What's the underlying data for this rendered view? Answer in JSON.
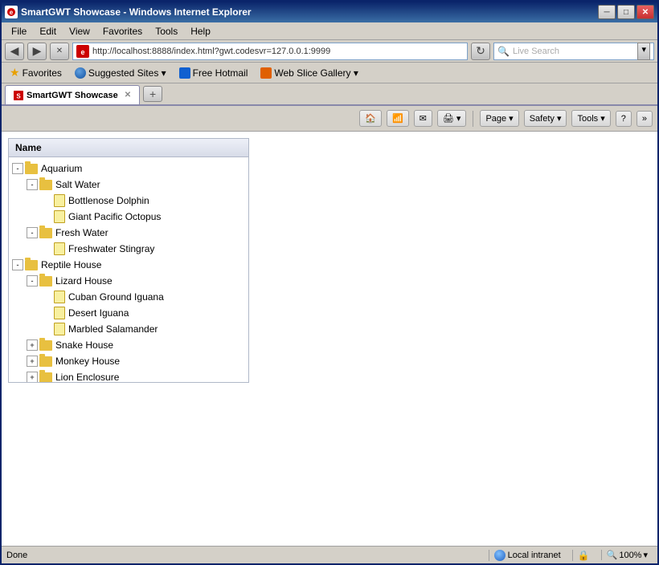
{
  "window": {
    "title": "SmartGWT Showcase - Windows Internet Explorer",
    "favicon_text": "e"
  },
  "titlebar": {
    "title": "SmartGWT Showcase - Windows Internet Explorer",
    "minimize": "─",
    "maximize": "□",
    "close": "✕"
  },
  "addressbar": {
    "url": "http://localhost:8888/index.html?gwt.codesvr=127.0.0.1:9999",
    "search_placeholder": "Live Search"
  },
  "menu": {
    "items": [
      "File",
      "Edit",
      "View",
      "Favorites",
      "Tools",
      "Help"
    ]
  },
  "favorites_bar": {
    "items": [
      {
        "label": "Favorites",
        "has_chevron": false
      },
      {
        "label": "Suggested Sites ▾",
        "has_chevron": false
      },
      {
        "label": "Free Hotmail",
        "has_chevron": false
      },
      {
        "label": "Web Slice Gallery ▾",
        "has_chevron": false
      }
    ]
  },
  "tab": {
    "label": "SmartGWT Showcase",
    "close": "✕"
  },
  "toolbar": {
    "page_label": "Page ▾",
    "safety_label": "Safety ▾",
    "tools_label": "Tools ▾",
    "help_label": "?"
  },
  "tree": {
    "header": "Name",
    "nodes": [
      {
        "id": 1,
        "level": 0,
        "type": "folder",
        "label": "Aquarium",
        "expand": "-",
        "expanded": true
      },
      {
        "id": 2,
        "level": 1,
        "type": "folder",
        "label": "Salt Water",
        "expand": "-",
        "expanded": true
      },
      {
        "id": 3,
        "level": 2,
        "type": "leaf",
        "label": "Bottlenose Dolphin"
      },
      {
        "id": 4,
        "level": 2,
        "type": "leaf",
        "label": "Giant Pacific Octopus"
      },
      {
        "id": 5,
        "level": 1,
        "type": "folder",
        "label": "Fresh Water",
        "expand": "-",
        "expanded": true
      },
      {
        "id": 6,
        "level": 2,
        "type": "leaf",
        "label": "Freshwater Stingray"
      },
      {
        "id": 7,
        "level": 0,
        "type": "folder",
        "label": "Reptile House",
        "expand": "-",
        "expanded": true
      },
      {
        "id": 8,
        "level": 1,
        "type": "folder",
        "label": "Lizard House",
        "expand": "-",
        "expanded": true
      },
      {
        "id": 9,
        "level": 2,
        "type": "leaf",
        "label": "Cuban Ground Iguana"
      },
      {
        "id": 10,
        "level": 2,
        "type": "leaf",
        "label": "Desert Iguana"
      },
      {
        "id": 11,
        "level": 2,
        "type": "leaf",
        "label": "Marbled Salamander"
      },
      {
        "id": 12,
        "level": 1,
        "type": "folder",
        "label": "Snake House",
        "expand": "+",
        "expanded": false
      },
      {
        "id": 13,
        "level": 1,
        "type": "folder",
        "label": "Monkey House",
        "expand": "+",
        "expanded": false
      },
      {
        "id": 14,
        "level": 1,
        "type": "folder",
        "label": "Lion Enclosure",
        "expand": "+",
        "expanded": false
      }
    ]
  },
  "statusbar": {
    "status": "Done",
    "zone": "Local intranet",
    "zoom": "100%"
  }
}
